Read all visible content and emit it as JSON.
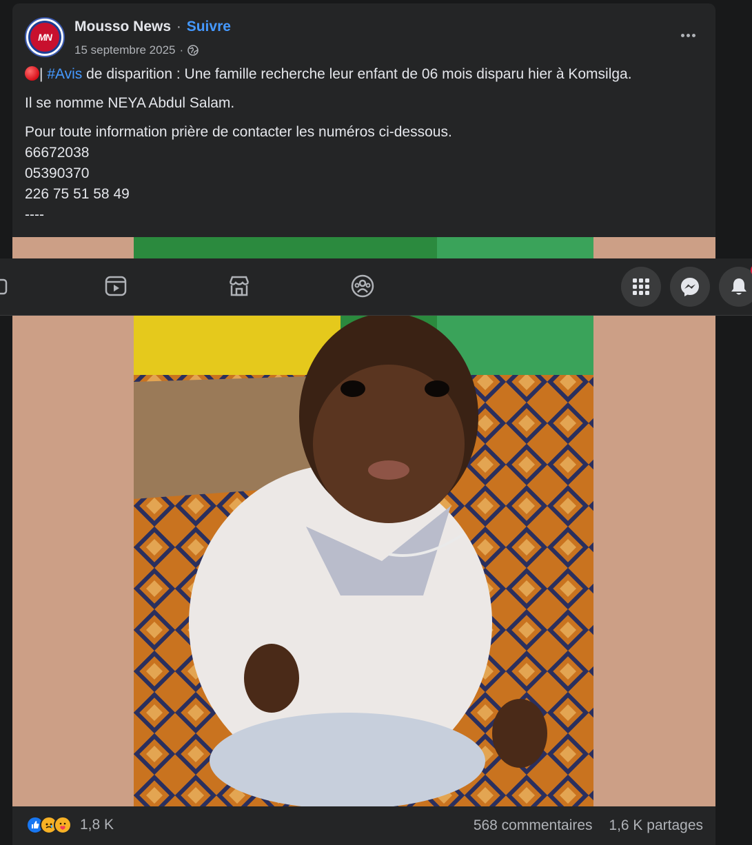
{
  "post": {
    "page_name": "Mousso News",
    "separator": "·",
    "follow_label": "Suivre",
    "date": "15 septembre 2025",
    "date_separator": "·",
    "avatar_initials": "MN",
    "privacy_icon": "globe-icon",
    "more_icon": "more-options-icon",
    "text": {
      "line1_separator": "|",
      "hashtag": "#Avis",
      "line1_rest": " de disparition : Une famille recherche leur  enfant de 06 mois disparu hier à Komsilga.",
      "line2": "Il se nomme NEYA Abdul Salam.",
      "line3": "Pour toute information prière de contacter les numéros ci-dessous.",
      "phones": [
        "66672038",
        "05390370",
        "226 75 51 58 49"
      ],
      "trailer": "----"
    },
    "photo_icon": "photo-of-missing-child"
  },
  "engagement": {
    "reaction_icons": [
      "like-icon",
      "sad-icon",
      "care-icon"
    ],
    "reaction_count": "1,8 K",
    "comments": "568 commentaires",
    "shares": "1,6 K partages"
  },
  "topnav": {
    "icons": [
      "home-icon",
      "video-icon",
      "marketplace-icon",
      "groups-icon"
    ],
    "right_buttons": [
      "menu-grid-icon",
      "messenger-icon",
      "notifications-icon"
    ]
  },
  "colors": {
    "background": "#18191a",
    "card": "#242526",
    "link": "#4599ff",
    "photo_matte": "#cc9f86",
    "badge": "#e41e3f"
  }
}
